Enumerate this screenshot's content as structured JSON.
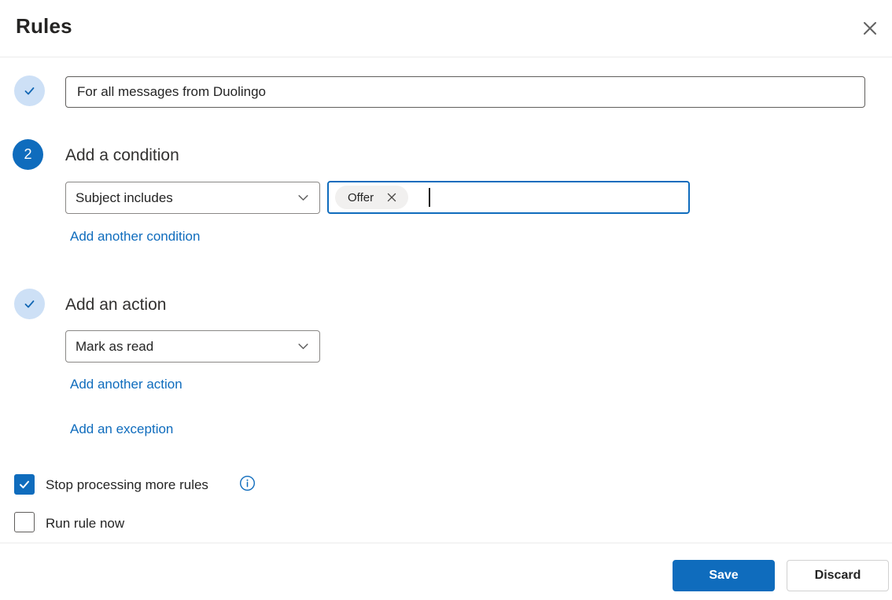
{
  "header": {
    "title": "Rules"
  },
  "rule_name": {
    "value": "For all messages from Duolingo",
    "step_state": "complete"
  },
  "condition_section": {
    "step_number": "2",
    "heading": "Add a condition",
    "type_select": {
      "value": "Subject includes"
    },
    "value_input": {
      "chips": [
        {
          "label": "Offer"
        }
      ],
      "focused": true
    },
    "add_link": "Add another condition"
  },
  "action_section": {
    "step_state": "complete",
    "heading": "Add an action",
    "type_select": {
      "value": "Mark as read"
    },
    "add_link": "Add another action",
    "exception_link": "Add an exception"
  },
  "options": {
    "stop_processing": {
      "label": "Stop processing more rules",
      "checked": true,
      "info_icon": "info-circle"
    },
    "run_now": {
      "label": "Run rule now",
      "checked": false
    }
  },
  "footer": {
    "save_label": "Save",
    "discard_label": "Discard"
  },
  "colors": {
    "primary": "#0f6cbd",
    "step_done_bg": "#cde0f6",
    "step_done_check": "#1267b4",
    "link": "#0f6cbd",
    "chip_bg": "#f1f0ef",
    "divider": "#ebebeb",
    "input_border": "#605e5c",
    "dropdown_border": "#8a8886",
    "icon_gray": "#616161"
  }
}
